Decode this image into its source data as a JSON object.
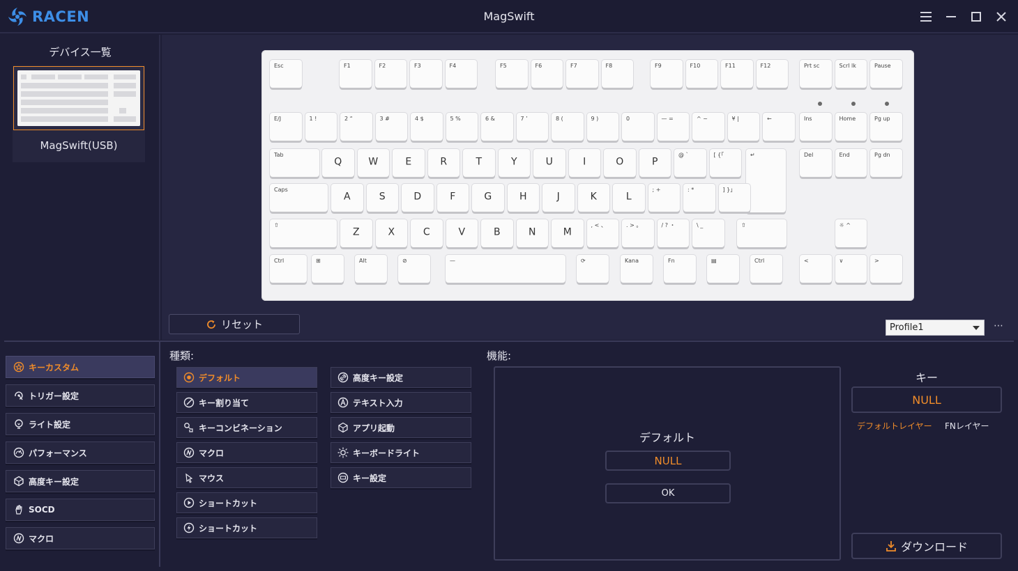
{
  "app": {
    "brand": "RACEN",
    "title": "MagSwift"
  },
  "colors": {
    "background": "#1e1e36",
    "accent": "#f08c2a",
    "brand": "#3d8ee6",
    "panel": "#26263f",
    "border": "#3e3e5a"
  },
  "device_panel": {
    "heading": "デバイス一覧",
    "device_name": "MagSwift(USB)"
  },
  "keyboard": {
    "rows": [
      [
        {
          "id": "esc",
          "label": "Esc"
        },
        {
          "id": "f1",
          "label": "F1"
        },
        {
          "id": "f2",
          "label": "F2"
        },
        {
          "id": "f3",
          "label": "F3"
        },
        {
          "id": "f4",
          "label": "F4"
        },
        {
          "id": "f5",
          "label": "F5"
        },
        {
          "id": "f6",
          "label": "F6"
        },
        {
          "id": "f7",
          "label": "F7"
        },
        {
          "id": "f8",
          "label": "F8"
        },
        {
          "id": "f9",
          "label": "F9"
        },
        {
          "id": "f10",
          "label": "F10"
        },
        {
          "id": "f11",
          "label": "F11"
        },
        {
          "id": "f12",
          "label": "F12"
        },
        {
          "id": "prtsc",
          "label": "Prt sc"
        },
        {
          "id": "scrlk",
          "label": "Scrl lk"
        },
        {
          "id": "pause",
          "label": "Pause"
        }
      ],
      [
        {
          "id": "ej",
          "label": "E/J"
        },
        {
          "id": "1",
          "label": "1 !"
        },
        {
          "id": "2",
          "label": "2 “"
        },
        {
          "id": "3",
          "label": "3 #"
        },
        {
          "id": "4",
          "label": "4 $"
        },
        {
          "id": "5",
          "label": "5 %"
        },
        {
          "id": "6",
          "label": "6 &"
        },
        {
          "id": "7",
          "label": "7 ’"
        },
        {
          "id": "8",
          "label": "8 ("
        },
        {
          "id": "9",
          "label": "9 )"
        },
        {
          "id": "0",
          "label": "0"
        },
        {
          "id": "minus",
          "label": "— ="
        },
        {
          "id": "caret",
          "label": "^ ~"
        },
        {
          "id": "yen",
          "label": "¥ |"
        },
        {
          "id": "bksp",
          "label": "←"
        },
        {
          "id": "ins",
          "label": "Ins"
        },
        {
          "id": "home",
          "label": "Home"
        },
        {
          "id": "pgup",
          "label": "Pg up"
        }
      ],
      [
        {
          "id": "tab",
          "label": "Tab"
        },
        {
          "id": "q",
          "label": "Q"
        },
        {
          "id": "w",
          "label": "W"
        },
        {
          "id": "e",
          "label": "E"
        },
        {
          "id": "r",
          "label": "R"
        },
        {
          "id": "t",
          "label": "T"
        },
        {
          "id": "y",
          "label": "Y"
        },
        {
          "id": "u",
          "label": "U"
        },
        {
          "id": "i",
          "label": "I"
        },
        {
          "id": "o",
          "label": "O"
        },
        {
          "id": "p",
          "label": "P"
        },
        {
          "id": "at",
          "label": "@ `"
        },
        {
          "id": "lbr",
          "label": "[ {「"
        },
        {
          "id": "enter",
          "label": "↵"
        },
        {
          "id": "del",
          "label": "Del"
        },
        {
          "id": "end",
          "label": "End"
        },
        {
          "id": "pgdn",
          "label": "Pg dn"
        }
      ],
      [
        {
          "id": "caps",
          "label": "Caps"
        },
        {
          "id": "a",
          "label": "A"
        },
        {
          "id": "s",
          "label": "S"
        },
        {
          "id": "d",
          "label": "D"
        },
        {
          "id": "f",
          "label": "F"
        },
        {
          "id": "g",
          "label": "G"
        },
        {
          "id": "h",
          "label": "H"
        },
        {
          "id": "j",
          "label": "J"
        },
        {
          "id": "k",
          "label": "K"
        },
        {
          "id": "l",
          "label": "L"
        },
        {
          "id": "semi",
          "label": "; +"
        },
        {
          "id": "colon",
          "label": ": *"
        },
        {
          "id": "rbr",
          "label": "] }」"
        }
      ],
      [
        {
          "id": "lshift",
          "label": "⇧"
        },
        {
          "id": "z",
          "label": "Z"
        },
        {
          "id": "x",
          "label": "X"
        },
        {
          "id": "c",
          "label": "C"
        },
        {
          "id": "v",
          "label": "V"
        },
        {
          "id": "b",
          "label": "B"
        },
        {
          "id": "n",
          "label": "N"
        },
        {
          "id": "m",
          "label": "M"
        },
        {
          "id": "comma",
          "label": ", < 、"
        },
        {
          "id": "period",
          "label": ". > 。"
        },
        {
          "id": "slash",
          "label": "/ ? ・"
        },
        {
          "id": "bslash",
          "label": "\\ _"
        },
        {
          "id": "rshift",
          "label": "⇧"
        },
        {
          "id": "up",
          "label": "☼ ^"
        }
      ],
      [
        {
          "id": "lctrl",
          "label": "Ctrl"
        },
        {
          "id": "win",
          "label": "⊞"
        },
        {
          "id": "lalt",
          "label": "Alt"
        },
        {
          "id": "muhenkan",
          "label": "⊘"
        },
        {
          "id": "space",
          "label": "—"
        },
        {
          "id": "henkan",
          "label": "⟳"
        },
        {
          "id": "kana",
          "label": "Kana"
        },
        {
          "id": "fn",
          "label": "Fn"
        },
        {
          "id": "menu",
          "label": "▤"
        },
        {
          "id": "rctrl",
          "label": "Ctrl"
        },
        {
          "id": "left",
          "label": "<"
        },
        {
          "id": "down",
          "label": "∨"
        },
        {
          "id": "right",
          "label": ">"
        }
      ]
    ]
  },
  "toolbar": {
    "reset_label": "リセット",
    "profile_value": "Profile1",
    "more_label": "⋯"
  },
  "nav": {
    "items": [
      {
        "label": "キーカスタム",
        "icon": "star-icon",
        "active": true
      },
      {
        "label": "トリガー設定",
        "icon": "trigger-icon",
        "active": false
      },
      {
        "label": "ライト設定",
        "icon": "bulb-icon",
        "active": false
      },
      {
        "label": "パフォーマンス",
        "icon": "gauge-icon",
        "active": false
      },
      {
        "label": "高度キー設定",
        "icon": "cube-icon",
        "active": false
      },
      {
        "label": "SOCD",
        "icon": "hand-icon",
        "active": false
      },
      {
        "label": "マクロ",
        "icon": "macro-icon",
        "active": false
      }
    ]
  },
  "types": {
    "heading": "種類:",
    "left_column": [
      {
        "label": "デフォルト",
        "icon": "radio-icon",
        "active": true
      },
      {
        "label": "キー割り当て",
        "icon": "assign-icon",
        "active": false
      },
      {
        "label": "キーコンビネーション",
        "icon": "combo-icon",
        "active": false
      },
      {
        "label": "マクロ",
        "icon": "macro-icon",
        "active": false
      },
      {
        "label": "マウス",
        "icon": "mouse-icon",
        "active": false
      },
      {
        "label": "ショートカット",
        "icon": "play-icon",
        "active": false
      },
      {
        "label": "ショートカット",
        "icon": "bolt-icon",
        "active": false
      }
    ],
    "right_column": [
      {
        "label": "高度キー設定",
        "icon": "link-icon",
        "active": false
      },
      {
        "label": "テキスト入力",
        "icon": "text-icon",
        "active": false
      },
      {
        "label": "アプリ起動",
        "icon": "box-icon",
        "active": false
      },
      {
        "label": "キーボードライト",
        "icon": "sun-icon",
        "active": false
      },
      {
        "label": "キー設定",
        "icon": "keyset-icon",
        "active": false
      }
    ]
  },
  "function": {
    "heading": "機能:",
    "title": "デフォルト",
    "value": "NULL",
    "ok_label": "OK"
  },
  "key_panel": {
    "heading": "キー",
    "value": "NULL",
    "layers": [
      {
        "label": "デフォルトレイヤー",
        "active": true
      },
      {
        "label": "FNレイヤー",
        "active": false
      }
    ],
    "download_label": "ダウンロード"
  }
}
